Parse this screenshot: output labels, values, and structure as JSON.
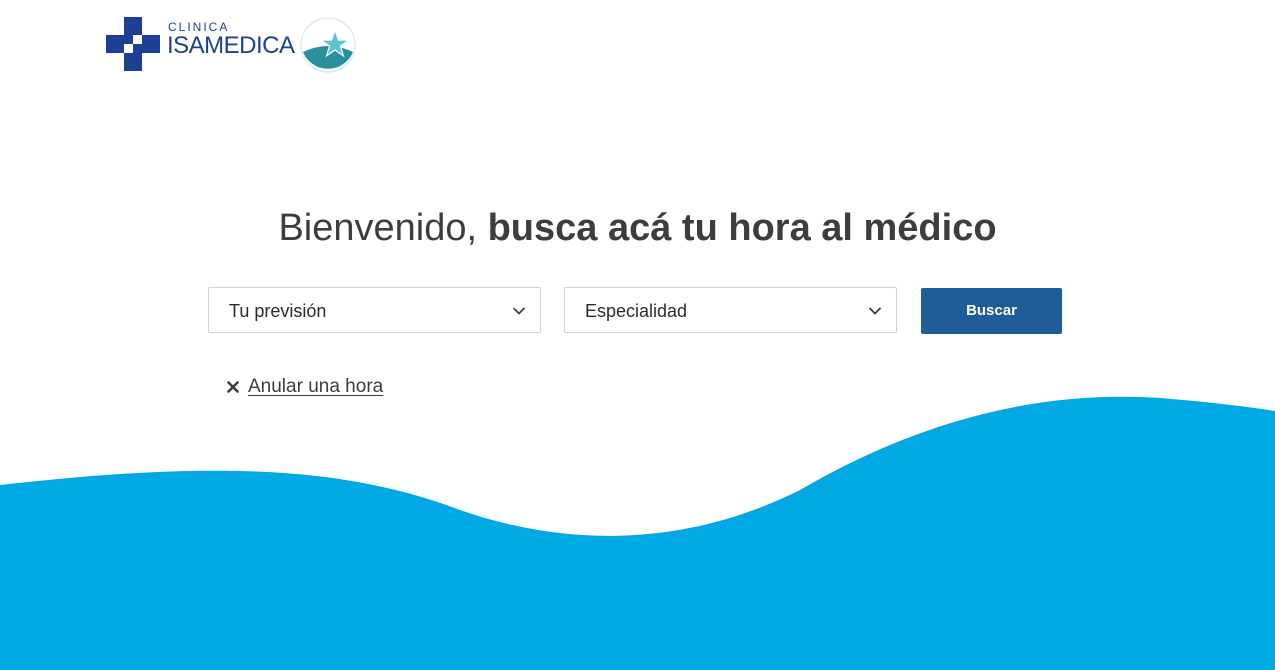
{
  "brand": {
    "name_small": "CLINICA",
    "name_big": "ISAMEDICA",
    "logo_color": "#1d3f95",
    "seal_color": "#2a8f9e",
    "logo_icon": "medical-cross-logo",
    "seal_icon": "accreditation-star-seal"
  },
  "headline": {
    "light": "Bienvenido, ",
    "bold": "busca acá tu hora al médico"
  },
  "search": {
    "prevision_label": "Tu previsión",
    "especialidad_label": "Especialidad",
    "button_label": "Buscar",
    "chevron_icon": "chevron-down-icon"
  },
  "cancel": {
    "icon": "close-icon",
    "label": "Anular una hora"
  },
  "colors": {
    "primary_button": "#1f5d99",
    "wave": "#00a9e3",
    "text": "#3d3d3d"
  }
}
